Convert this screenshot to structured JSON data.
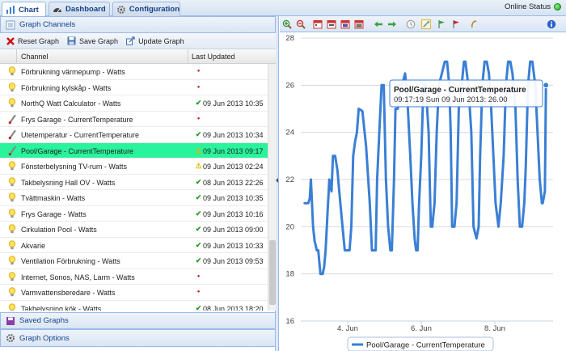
{
  "tabs": [
    {
      "label": "Chart",
      "active": true
    },
    {
      "label": "Dashboard",
      "active": false
    },
    {
      "label": "Configuration",
      "active": false
    }
  ],
  "online_status": {
    "label": "Online Status",
    "color": "#1aa51a"
  },
  "left": {
    "graph_channels": "Graph Channels",
    "toolbar": {
      "reset": "Reset Graph",
      "save": "Save Graph",
      "update": "Update Graph"
    },
    "columns": {
      "channel": "Channel",
      "last_updated": "Last Updated"
    },
    "rows": [
      {
        "name": "Förbrukning värmepump - Watts",
        "icon": "bulb-icon",
        "status": "error",
        "date": ""
      },
      {
        "name": "Förbrukning kylskåp - Watts",
        "icon": "bulb-icon",
        "status": "error",
        "date": ""
      },
      {
        "name": "NorthQ Watt Calculator - Watts",
        "icon": "bulb-icon",
        "status": "ok",
        "date": "09 Jun 2013 10:35"
      },
      {
        "name": "Frys Garage - CurrentTemperature",
        "icon": "thermometer-icon",
        "status": "error",
        "date": ""
      },
      {
        "name": "Utetemperatur - CurrentTemperature",
        "icon": "thermometer-icon",
        "status": "ok",
        "date": "09 Jun 2013 10:34"
      },
      {
        "name": "Pool/Garage - CurrentTemperature",
        "icon": "thermometer-icon",
        "status": "warning",
        "date": "09 Jun 2013 09:17",
        "selected": true
      },
      {
        "name": "Fönsterbelysning TV-rum - Watts",
        "icon": "bulb-icon",
        "status": "warning",
        "date": "09 Jun 2013 02:24"
      },
      {
        "name": "Takbelysning Hall OV - Watts",
        "icon": "bulb-icon",
        "status": "ok",
        "date": "08 Jun 2013 22:26"
      },
      {
        "name": "Tvättmaskin - Watts",
        "icon": "bulb-icon",
        "status": "ok",
        "date": "09 Jun 2013 10:35"
      },
      {
        "name": "Frys Garage - Watts",
        "icon": "bulb-icon",
        "status": "ok",
        "date": "09 Jun 2013 10:16"
      },
      {
        "name": "Cirkulation Pool - Watts",
        "icon": "bulb-icon",
        "status": "ok",
        "date": "09 Jun 2013 09:00"
      },
      {
        "name": "Akvarie",
        "icon": "bulb-icon",
        "status": "ok",
        "date": "09 Jun 2013 10:33"
      },
      {
        "name": "Ventilation Förbrukning - Watts",
        "icon": "bulb-icon",
        "status": "ok",
        "date": "09 Jun 2013 09:53"
      },
      {
        "name": "Internet, Sonos, NAS, Larm - Watts",
        "icon": "bulb-icon",
        "status": "error",
        "date": ""
      },
      {
        "name": "Varmvattensberedare - Watts",
        "icon": "bulb-icon",
        "status": "error",
        "date": ""
      },
      {
        "name": "Takbelysning kök - Watts",
        "icon": "bulb-icon",
        "status": "ok",
        "date": "08 Jun 2013 18:20"
      }
    ],
    "saved_graphs": "Saved Graphs",
    "graph_options": "Graph Options"
  },
  "colors": {
    "series": "#3a7fd5",
    "selected_row": "#29f39b",
    "ok": "#2a9a2a",
    "error": "#cc1111",
    "warning": "#e3b400"
  },
  "chart_data": {
    "type": "line",
    "y_ticks": [
      16,
      18,
      20,
      22,
      24,
      26,
      28
    ],
    "ylim": [
      16,
      28
    ],
    "x_ticks": [
      "4. Jun",
      "6. Jun",
      "8. Jun"
    ],
    "grid": true,
    "legend_position": "bottom-center",
    "series": [
      {
        "name": "Pool/Garage - CurrentTemperature",
        "x": [
          2.83,
          2.93,
          2.97,
          3.0,
          3.06,
          3.1,
          3.16,
          3.2,
          3.26,
          3.32,
          3.36,
          3.4,
          3.46,
          3.5,
          3.56,
          3.6,
          3.66,
          3.72,
          3.8,
          3.86,
          3.92,
          3.96,
          4.0,
          4.05,
          4.1,
          4.15,
          4.2,
          4.25,
          4.3,
          4.4,
          4.5,
          4.6,
          4.66,
          4.72,
          4.76,
          4.8,
          4.86,
          4.92,
          4.98,
          5.04,
          5.1,
          5.16,
          5.2,
          5.26,
          5.3,
          5.36,
          5.42,
          5.48,
          5.56,
          5.62,
          5.7,
          5.76,
          5.82,
          5.86,
          5.9,
          5.94,
          6.0,
          6.06,
          6.12,
          6.2,
          6.26,
          6.3,
          6.36,
          6.42,
          6.48,
          6.56,
          6.64,
          6.7,
          6.76,
          6.8,
          6.84,
          6.9,
          6.96,
          7.02,
          7.1,
          7.16,
          7.2,
          7.28,
          7.36,
          7.42,
          7.5,
          7.56,
          7.6,
          7.66,
          7.72,
          7.78,
          7.84,
          7.9,
          7.96,
          8.02,
          8.1,
          8.16,
          8.24,
          8.3,
          8.36,
          8.42,
          8.48,
          8.56,
          8.62,
          8.68,
          8.74,
          8.8,
          8.84,
          8.9,
          8.96,
          9.02,
          9.1,
          9.16,
          9.22,
          9.28,
          9.3,
          9.36,
          9.39
        ],
        "y": [
          21,
          21,
          21.2,
          22,
          20,
          19.4,
          19,
          19,
          18,
          18,
          18.3,
          19,
          20.8,
          22,
          21.5,
          23,
          23,
          22.4,
          21,
          20,
          19,
          19,
          19,
          19,
          20,
          23,
          23.6,
          24,
          25,
          24.9,
          23.4,
          21,
          19,
          19,
          19,
          22,
          24,
          26,
          26,
          22,
          20,
          19,
          19,
          22,
          25,
          25,
          26,
          26,
          26.5,
          25.5,
          23,
          21,
          19.5,
          19,
          19,
          21,
          23,
          26,
          26,
          24,
          20,
          20,
          21,
          24,
          26,
          26.5,
          27,
          27,
          26,
          24,
          20,
          20,
          21,
          25,
          26,
          27,
          27,
          26,
          24,
          20,
          19.5,
          20,
          23,
          26,
          27,
          27,
          26.5,
          25,
          23,
          21,
          20,
          21,
          23,
          26,
          27,
          27,
          26.5,
          25,
          22,
          20,
          20,
          21,
          22.5,
          26,
          27,
          27,
          26,
          24,
          22,
          21,
          21,
          21.5,
          26
        ]
      }
    ],
    "tooltip": {
      "title": "Pool/Garage - CurrentTemperature",
      "detail": "09:17:19 Sun 09 Jun 2013: 26.00"
    }
  }
}
